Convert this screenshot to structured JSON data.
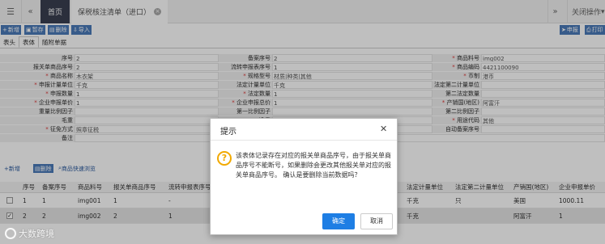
{
  "topbar": {
    "home_tab": "首页",
    "doc_tab": "保税核注清单（进口）",
    "close_ops": "关闭操作"
  },
  "toolbar": {
    "new": "新增",
    "save": "暂存",
    "delete": "删除",
    "import": "导入",
    "declare": "申报",
    "print": "打印"
  },
  "subtabs": [
    "表头",
    "表体",
    "随附单据"
  ],
  "form": {
    "rows": [
      [
        {
          "label": "序号",
          "value": "2",
          "req": false
        },
        {
          "label": "备案序号",
          "value": "2",
          "req": false
        },
        {
          "label": "商品料号",
          "value": "img002",
          "req": true
        }
      ],
      [
        {
          "label": "报关单商品序号",
          "value": "2",
          "req": false
        },
        {
          "label": "流转申报表序号",
          "value": "1",
          "req": false
        },
        {
          "label": "商品编码",
          "value": "4421100090",
          "req": true
        }
      ],
      [
        {
          "label": "商品名称",
          "value": "木衣架",
          "req": true
        },
        {
          "label": "规格型号",
          "value": "材质|种类|其他",
          "req": true
        },
        {
          "label": "币制",
          "value": "港币",
          "req": true
        }
      ],
      [
        {
          "label": "申报计量单位",
          "value": "千克",
          "req": true
        },
        {
          "label": "法定计量单位",
          "value": "千克",
          "req": false
        },
        {
          "label": "法定第二计量单位",
          "value": "",
          "req": false
        }
      ],
      [
        {
          "label": "申报数量",
          "value": "1",
          "req": true
        },
        {
          "label": "法定数量",
          "value": "1",
          "req": true
        },
        {
          "label": "第二法定数量",
          "value": "",
          "req": false
        }
      ],
      [
        {
          "label": "企业申报单价",
          "value": "1",
          "req": true
        },
        {
          "label": "企业申报总价",
          "value": "1",
          "req": true
        },
        {
          "label": "产销国(地区)",
          "value": "阿富汗",
          "req": true
        }
      ],
      [
        {
          "label": "重量比例因子",
          "value": "",
          "req": false
        },
        {
          "label": "第一比例因子",
          "value": "",
          "req": false
        },
        {
          "label": "第二比例因子",
          "value": "",
          "req": false
        }
      ],
      [
        {
          "label": "毛重",
          "value": "",
          "req": false
        },
        {
          "label": "净重",
          "value": "",
          "req": false
        },
        {
          "label": "用途代码",
          "value": "其他",
          "req": true
        }
      ],
      [
        {
          "label": "征免方式",
          "value": "照章征税",
          "req": true
        },
        {
          "label": "单耗版本号",
          "value": "",
          "req": false
        },
        {
          "label": "自动备案序号",
          "value": "",
          "req": false
        }
      ],
      [
        {
          "label": "备注",
          "value": "",
          "req": false
        }
      ]
    ]
  },
  "listbar": {
    "new": "新增",
    "delete": "删除",
    "quick_browse": "商品快速浏览"
  },
  "table": {
    "headers": [
      "序号",
      "备案序号",
      "商品料号",
      "报关单商品序号",
      "流转申报表序号",
      "法定计量单位",
      "法定第二计量单位",
      "产销国(地区)",
      "企业申报单价"
    ],
    "rows": [
      {
        "checked": false,
        "cells": [
          "1",
          "1",
          "img001",
          "1",
          "-",
          "千克",
          "只",
          "美国",
          "1000.11"
        ]
      },
      {
        "checked": true,
        "cells": [
          "2",
          "2",
          "img002",
          "2",
          "1",
          "千克",
          "",
          "阿富汗",
          "1"
        ]
      }
    ]
  },
  "modal": {
    "title": "提示",
    "icon_text": "?",
    "message": "该表体记录存在对应的报关单商品序号，由于报关单商品序号不能断号，如果删除会更改其他报关单对应的报关单商品序号。 确认是要删除当前数据吗？",
    "ok": "确定",
    "cancel": "取消"
  },
  "watermark": "大数跨境"
}
